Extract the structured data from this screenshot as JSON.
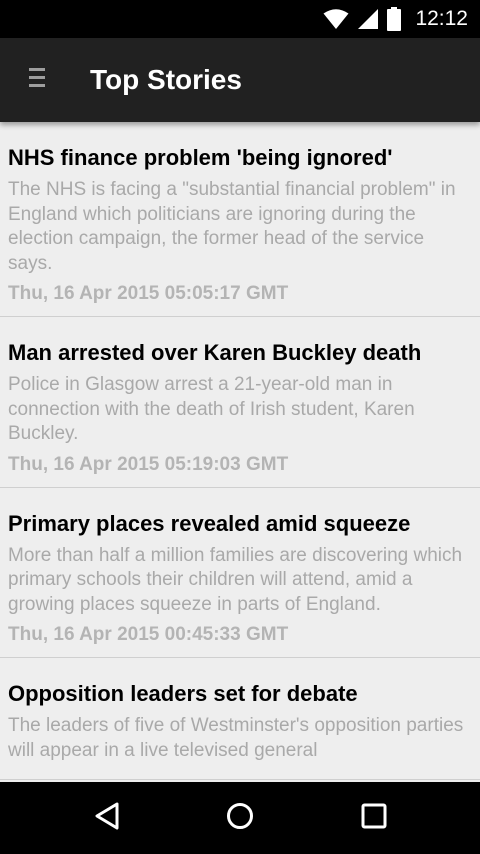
{
  "status_bar": {
    "time": "12:12",
    "icons": [
      "wifi-icon",
      "signal-icon",
      "battery-icon"
    ]
  },
  "toolbar": {
    "title": "Top Stories",
    "menu_icon": "menu-icon"
  },
  "stories": [
    {
      "title": "NHS finance problem 'being ignored'",
      "description": "The NHS is facing a \"substantial financial problem\" in England which politicians are ignoring during the election campaign, the former head of the service says.",
      "date": "Thu, 16 Apr 2015 05:05:17 GMT"
    },
    {
      "title": "Man arrested over Karen Buckley death",
      "description": "Police in Glasgow arrest a 21-year-old man in connection with the death of Irish student, Karen Buckley.",
      "date": "Thu, 16 Apr 2015 05:19:03 GMT"
    },
    {
      "title": "Primary places revealed amid squeeze",
      "description": "More than half a million families are discovering which primary schools their children will attend, amid a growing places squeeze in parts of England.",
      "date": "Thu, 16 Apr 2015 00:45:33 GMT"
    },
    {
      "title": "Opposition leaders set for debate",
      "description": "The leaders of five of Westminster's opposition parties will appear in a live televised general",
      "date": ""
    }
  ],
  "nav_bar": {
    "icons": [
      "back-icon",
      "home-icon",
      "recents-icon"
    ]
  },
  "colors": {
    "status_bar": "#000000",
    "toolbar": "#212121",
    "background": "#eeeeee",
    "title_text": "#000000",
    "description_text": "#a9a9a9",
    "date_text": "#b4b4b4"
  }
}
